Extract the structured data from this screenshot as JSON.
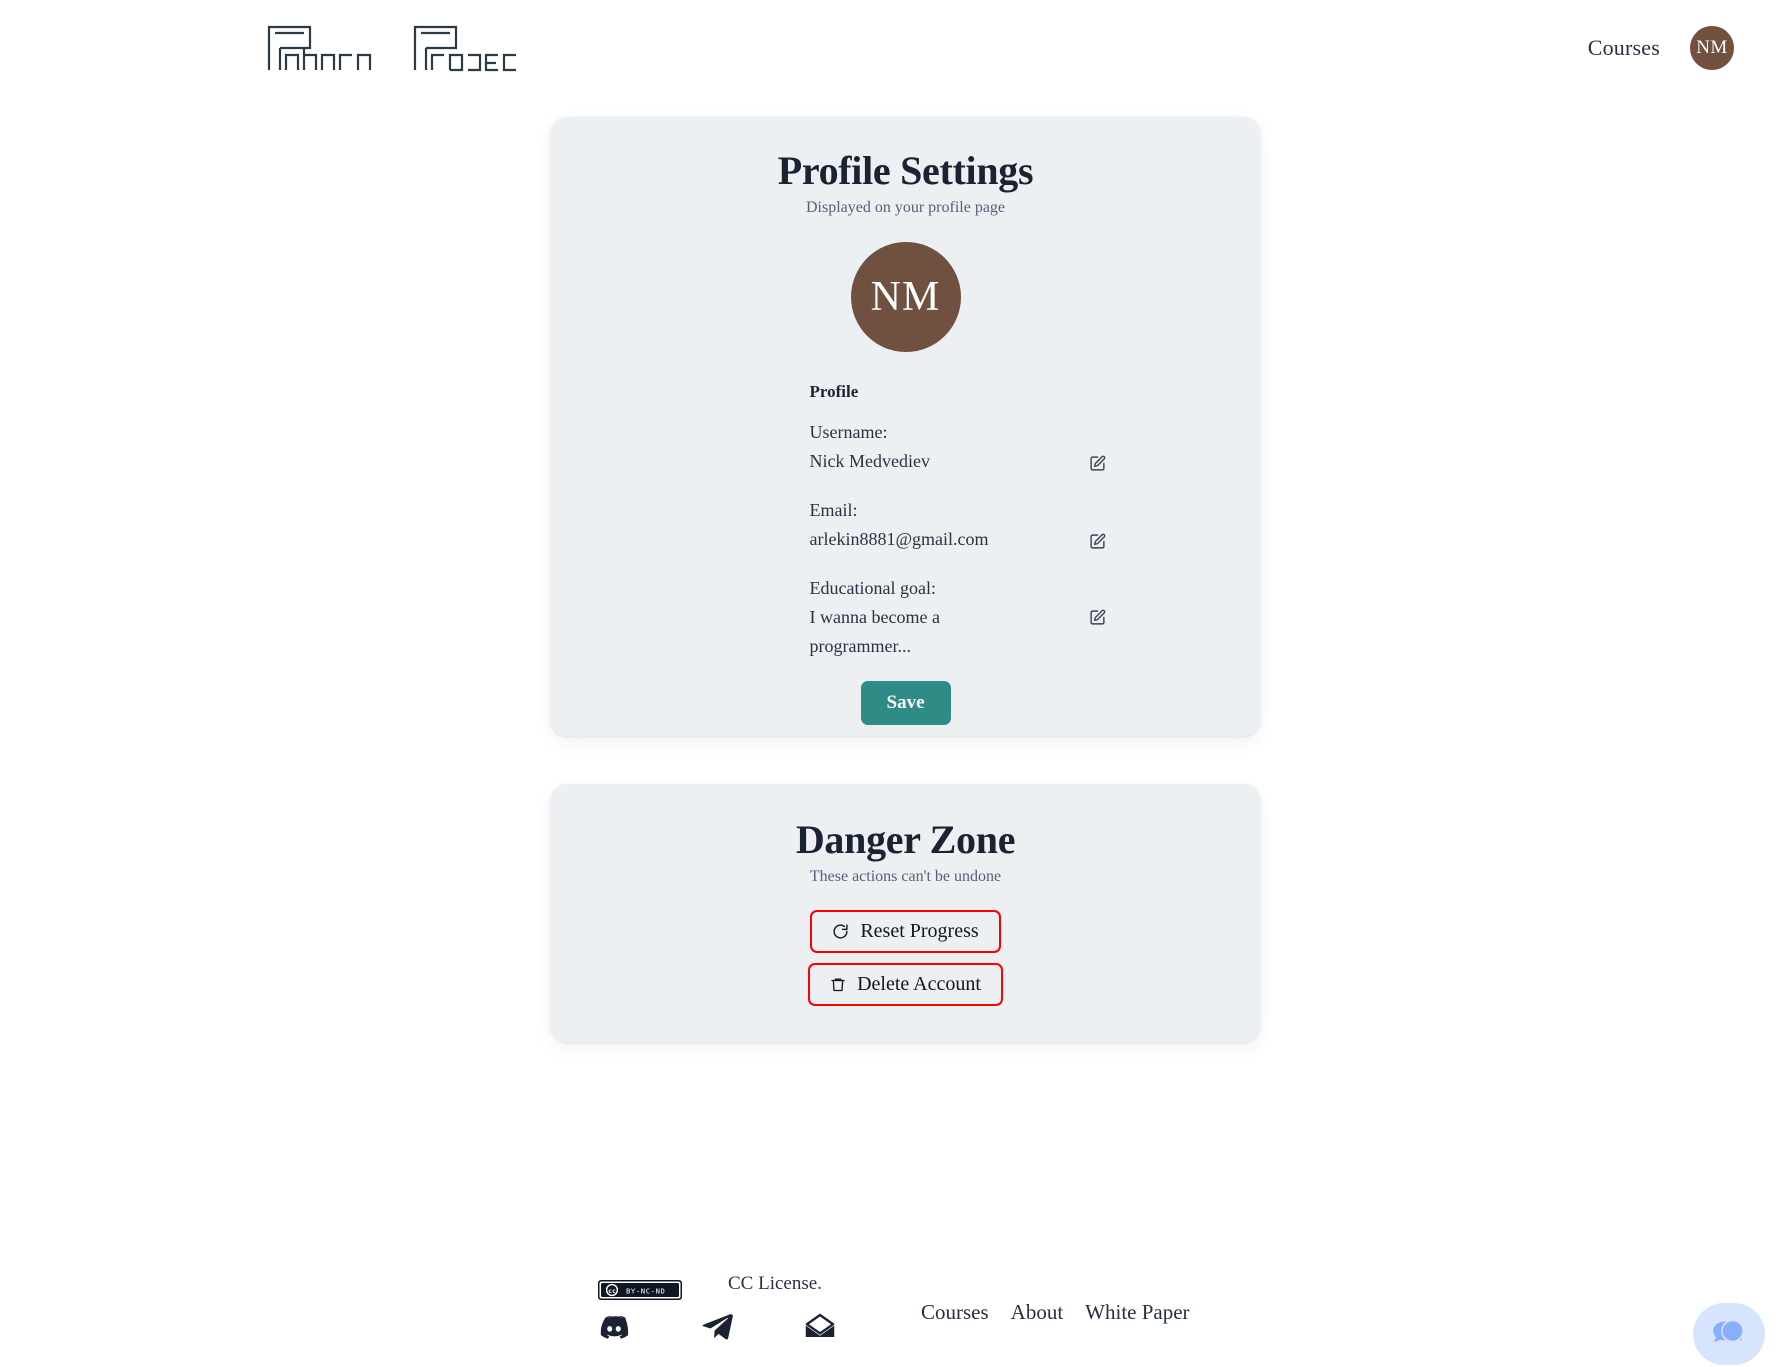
{
  "header": {
    "logo_text": "Pandora Project",
    "logo_word1": "Pandora",
    "logo_word2": "Project",
    "nav_courses": "Courses",
    "avatar_initials": "NM"
  },
  "profile_card": {
    "title": "Profile Settings",
    "subtitle": "Displayed on your profile page",
    "avatar_initials": "NM",
    "section_heading": "Profile",
    "fields": [
      {
        "label": "Username:",
        "value": "Nick Medvediev",
        "edit_icon": "square-pen-icon"
      },
      {
        "label": "Email:",
        "value": "arlekin8881@gmail.com",
        "edit_icon": "square-pen-icon"
      },
      {
        "label": "Educational goal:",
        "value": "I wanna become a programmer...",
        "edit_icon": "square-pen-icon"
      }
    ],
    "save_label": "Save"
  },
  "danger_card": {
    "title": "Danger Zone",
    "subtitle": "These actions can't be undone",
    "reset_label": "Reset Progress",
    "reset_icon": "refresh-cw-icon",
    "delete_label": "Delete Account",
    "delete_icon": "trash-icon"
  },
  "footer": {
    "cc_badge_cc": "cc",
    "cc_badge_terms": "BY-NC-ND",
    "cc_text": "CC License.",
    "social": [
      {
        "name": "discord-icon"
      },
      {
        "name": "telegram-icon"
      },
      {
        "name": "mail-icon"
      }
    ],
    "links": [
      {
        "label": "Courses"
      },
      {
        "label": "About"
      },
      {
        "label": "White Paper"
      }
    ]
  },
  "chat_widget": {
    "icon": "chat-bubbles-icon"
  },
  "colors": {
    "page_bg": "#ffffff",
    "card_bg": "#ecf0f2",
    "avatar_brown": "#70503f",
    "save_teal": "#2e8b85",
    "danger_red": "#ff0000",
    "text_dark": "#1b2231",
    "text_muted": "#55617a",
    "chat_bg": "#d6e4fd",
    "chat_fg": "#89aefb"
  }
}
